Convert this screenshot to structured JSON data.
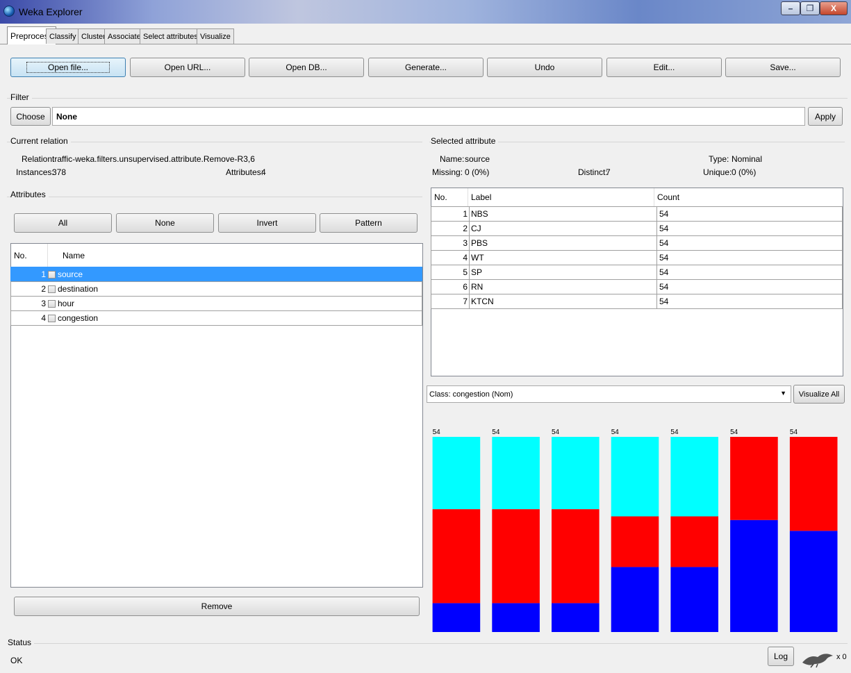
{
  "window": {
    "title": "Weka Explorer",
    "min": "–",
    "max": "❐",
    "close": "X"
  },
  "tabs": [
    "Preprocess",
    "Classify",
    "Cluster",
    "Associate",
    "Select attributes",
    "Visualize"
  ],
  "toolbar": [
    "Open file...",
    "Open URL...",
    "Open DB...",
    "Generate...",
    "Undo",
    "Edit...",
    "Save..."
  ],
  "filter": {
    "label": "Filter",
    "choose": "Choose",
    "value": "None",
    "apply": "Apply"
  },
  "current_relation": {
    "label": "Current relation",
    "relation_label": "Relation:",
    "relation": "traffic-weka.filters.unsupervised.attribute.Remove-R3,6",
    "instances_label": "Instances:",
    "instances": "378",
    "attributes_label": "Attributes:",
    "attributes": "4"
  },
  "attributes": {
    "label": "Attributes",
    "buttons": [
      "All",
      "None",
      "Invert",
      "Pattern"
    ],
    "col_no": "No.",
    "col_name": "Name",
    "rows": [
      {
        "no": "1",
        "name": "source"
      },
      {
        "no": "2",
        "name": "destination"
      },
      {
        "no": "3",
        "name": "hour"
      },
      {
        "no": "4",
        "name": "congestion"
      }
    ],
    "remove": "Remove"
  },
  "selected_attribute": {
    "label": "Selected attribute",
    "name_label": "Name:",
    "name": "source",
    "type_label": "Type:",
    "type": "Nominal",
    "missing_label": "Missing:",
    "missing": "0 (0%)",
    "distinct_label": "Distinct:",
    "distinct": "7",
    "unique_label": "Unique:",
    "unique": "0 (0%)",
    "col_no": "No.",
    "col_label": "Label",
    "col_count": "Count",
    "rows": [
      {
        "no": "1",
        "label": "NBS",
        "count": "54"
      },
      {
        "no": "2",
        "label": "CJ",
        "count": "54"
      },
      {
        "no": "3",
        "label": "PBS",
        "count": "54"
      },
      {
        "no": "4",
        "label": "WT",
        "count": "54"
      },
      {
        "no": "5",
        "label": "SP",
        "count": "54"
      },
      {
        "no": "6",
        "label": "RN",
        "count": "54"
      },
      {
        "no": "7",
        "label": "KTCN",
        "count": "54"
      }
    ]
  },
  "class_select": {
    "value": "Class: congestion (Nom)",
    "visualize_all": "Visualize All"
  },
  "status": {
    "label": "Status",
    "text": "OK",
    "log": "Log",
    "count": "x 0"
  },
  "colors": {
    "cyan": "#00ffff",
    "red": "#ff0000",
    "blue": "#0000ff"
  },
  "chart_data": {
    "type": "bar",
    "stacked": true,
    "categories": [
      "NBS",
      "CJ",
      "PBS",
      "WT",
      "SP",
      "RN",
      "KTCN"
    ],
    "totals": [
      54,
      54,
      54,
      54,
      54,
      54,
      54
    ],
    "series": [
      {
        "color": "#0000ff",
        "values": [
          8,
          8,
          8,
          18,
          18,
          31,
          28
        ]
      },
      {
        "color": "#ff0000",
        "values": [
          26,
          26,
          26,
          14,
          14,
          23,
          26
        ]
      },
      {
        "color": "#00ffff",
        "values": [
          20,
          20,
          20,
          22,
          22,
          0,
          0
        ]
      }
    ],
    "ylim": [
      0,
      54
    ]
  }
}
